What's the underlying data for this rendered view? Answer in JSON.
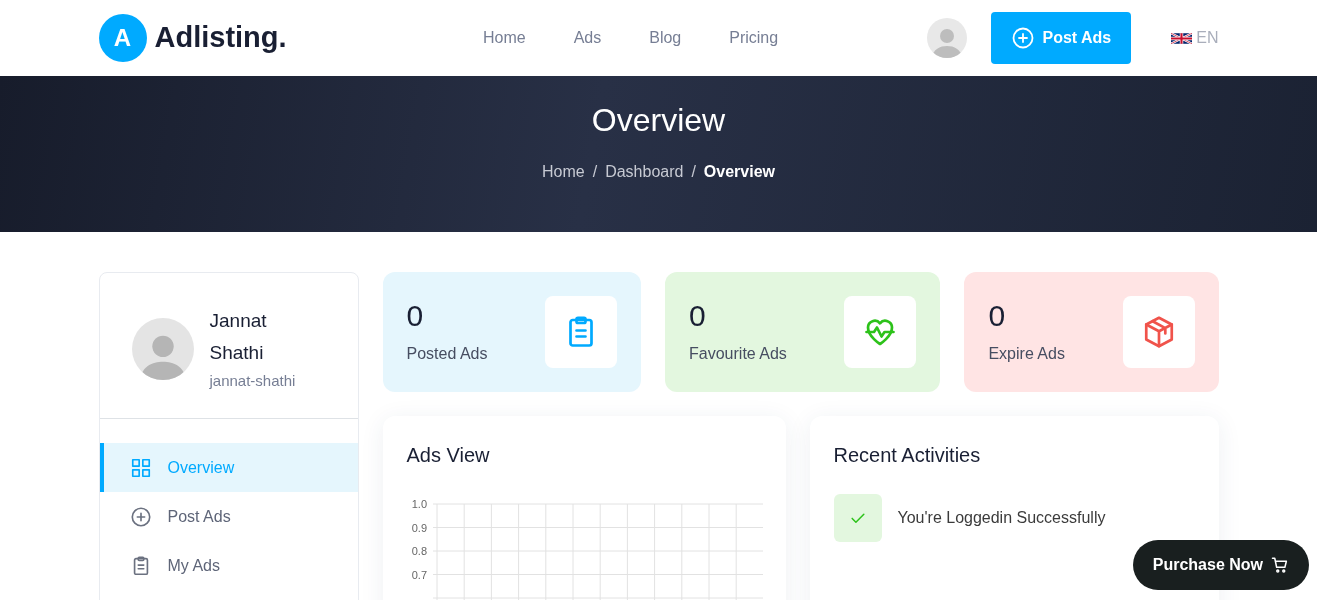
{
  "header": {
    "logo_letter": "A",
    "logo_text": "Adlisting.",
    "nav": [
      {
        "label": "Home",
        "selected": false
      },
      {
        "label": "Ads",
        "selected": false
      },
      {
        "label": "Blog",
        "selected": false
      },
      {
        "label": "Pricing",
        "selected": false
      }
    ],
    "post_button": "Post Ads",
    "language": "EN"
  },
  "banner": {
    "title": "Overview",
    "breadcrumb": {
      "separator": "/",
      "items": [
        {
          "label": "Home",
          "selected": false
        },
        {
          "label": "Dashboard",
          "selected": false
        },
        {
          "label": "Overview",
          "selected": true
        }
      ]
    }
  },
  "profile": {
    "name": "Jannat Shathi",
    "username": "jannat-shathi"
  },
  "sidebar": {
    "items": [
      {
        "kind": "grid",
        "label": "Overview",
        "selected": true
      },
      {
        "kind": "plus",
        "label": "Post Ads",
        "selected": false
      },
      {
        "kind": "clipboard",
        "label": "My Ads",
        "selected": false
      }
    ]
  },
  "stats": [
    {
      "kind": "clipboard",
      "value": "0",
      "label": "Posted Ads",
      "color": "#e5f6fd"
    },
    {
      "kind": "heart",
      "value": "0",
      "label": "Favourite Ads",
      "color": "#e3f7df"
    },
    {
      "kind": "box",
      "value": "0",
      "label": "Expire Ads",
      "color": "#ffe4e4"
    }
  ],
  "ads_view": {
    "title": "Ads View",
    "y_axis_labels": [
      "1.0",
      "0.9",
      "0.8",
      "0.7"
    ]
  },
  "recent_activities": {
    "title": "Recent Activities",
    "items": [
      {
        "text": "You're Loggedin Successfully"
      }
    ]
  },
  "purchase_button": "Purchase Now"
}
